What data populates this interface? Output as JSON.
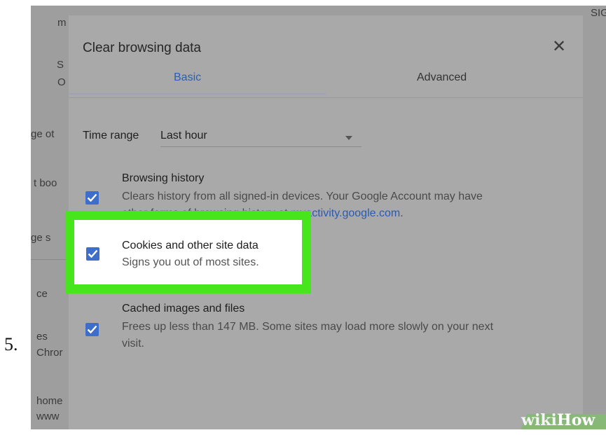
{
  "step": {
    "number": "5."
  },
  "background": {
    "fragments": [
      "m",
      "S",
      "O",
      "ge ot",
      "t boo",
      "ge s",
      "ce",
      "es",
      "Chror",
      "home",
      "www",
      "SIG"
    ]
  },
  "dialog": {
    "title": "Clear browsing data",
    "close_icon": "close-icon",
    "tabs": [
      {
        "label": "Basic",
        "active": true
      },
      {
        "label": "Advanced",
        "active": false
      }
    ],
    "time_range": {
      "label": "Time range",
      "value": "Last hour"
    },
    "options": [
      {
        "title": "Browsing history",
        "desc_line1": "Clears history from all signed-in devices. Your Google Account may have",
        "desc_line2_prefix": "other forms of browsing history at ",
        "desc_link": "myactivity.google.com",
        "desc_line2_suffix": ".",
        "checked": true
      },
      {
        "title": "Cookies and other site data",
        "desc": "Signs you out of most sites.",
        "checked": true,
        "highlighted": true
      },
      {
        "title": "Cached images and files",
        "desc_line1": "Frees up less than 147 MB. Some sites may load more slowly on your next",
        "desc_line2": "visit.",
        "checked": true
      }
    ]
  },
  "colors": {
    "highlight": "#47e51b",
    "checkbox": "#3d6ec9",
    "active_tab": "#2c5fb3",
    "link": "#2a5bb0"
  },
  "watermark": {
    "wiki": "wiki",
    "how": "How"
  }
}
